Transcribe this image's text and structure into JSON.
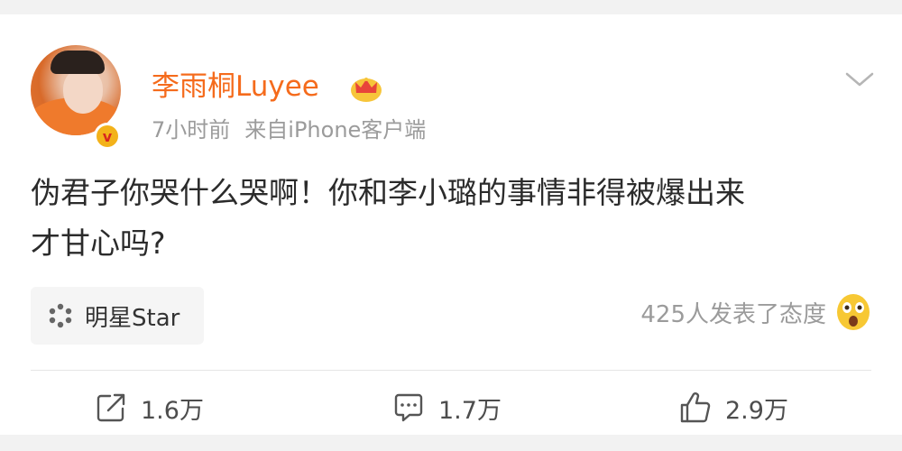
{
  "post": {
    "username": "李雨桐Luyee",
    "time": "7小时前",
    "source": "来自iPhone客户端",
    "text_line1": "伪君子你哭什么哭啊！你和李小璐的事情非得被爆出来",
    "text_line2": "才甘心吗?",
    "verified_mark": "v"
  },
  "topic": {
    "label": "明星Star"
  },
  "attitude": {
    "text": "425人发表了态度"
  },
  "actions": {
    "repost_count": "1.6万",
    "comment_count": "1.7万",
    "like_count": "2.9万"
  },
  "colors": {
    "username": "#f56b1c",
    "secondary_text": "#9b9b9b",
    "body_text": "#2b2b2b",
    "verify_badge": "#f3b21a"
  },
  "icons": [
    "crown-icon",
    "chevron-down-icon",
    "dots-icon",
    "shocked-face-icon",
    "repost-icon",
    "comment-icon",
    "like-icon"
  ]
}
